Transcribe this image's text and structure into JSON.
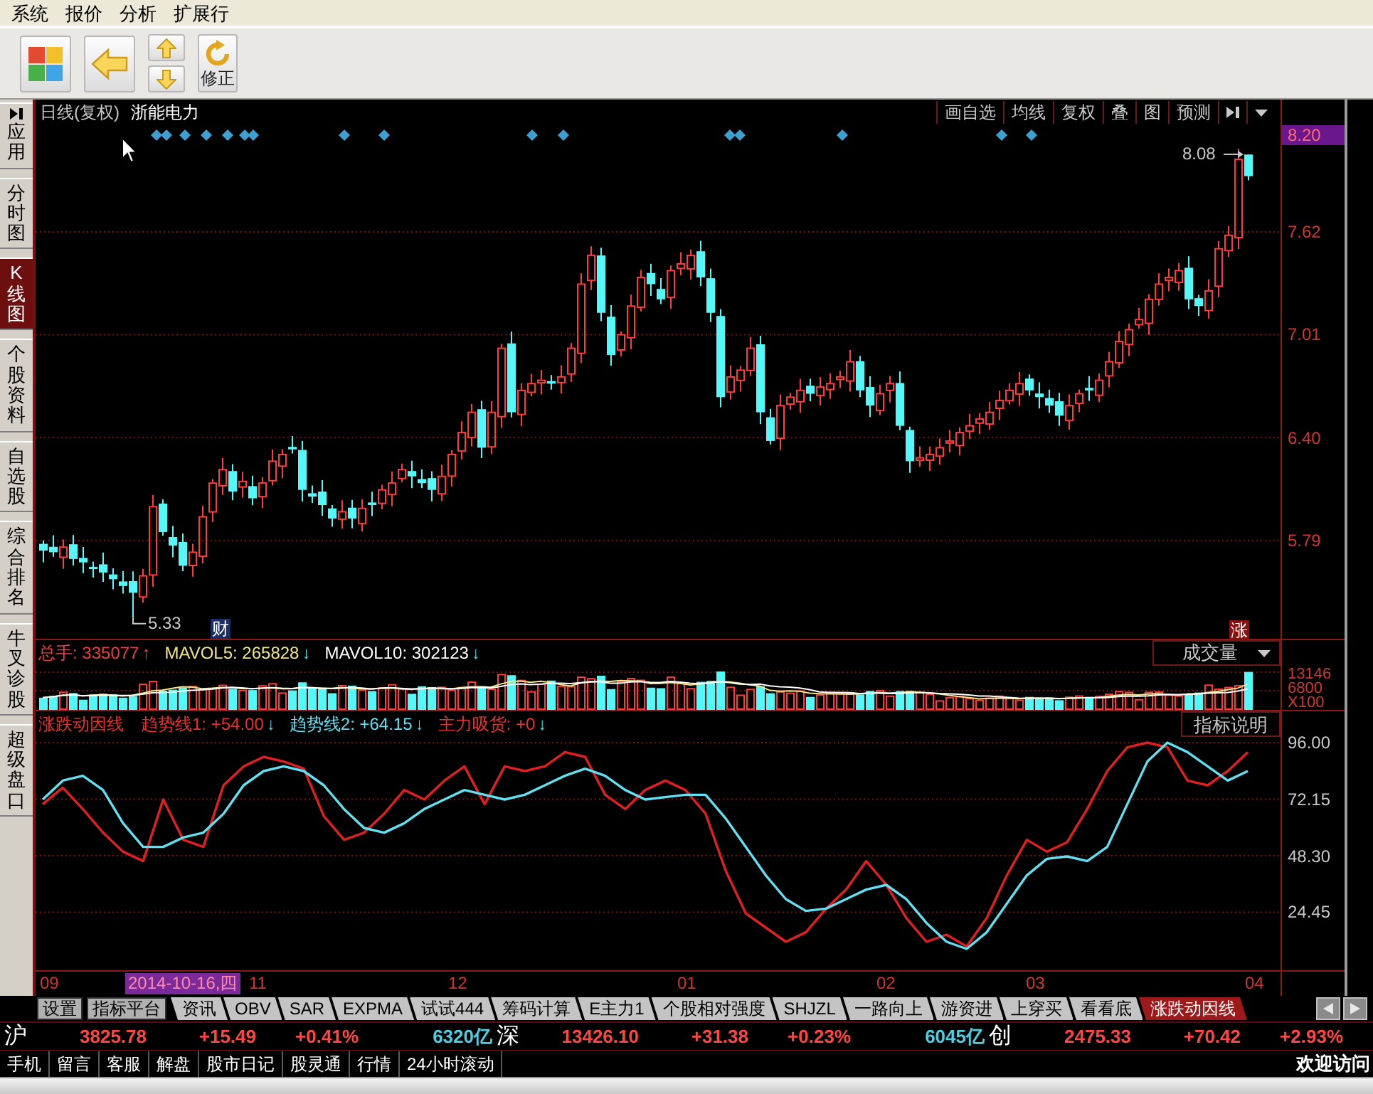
{
  "menu": [
    "系统",
    "报价",
    "分析",
    "扩展行"
  ],
  "toolbar": {
    "buttons": [
      {
        "kind": "home"
      },
      {
        "kind": "back"
      },
      {
        "kind": "up"
      },
      {
        "kind": "down"
      },
      {
        "kind": "refresh",
        "label": "修正"
      }
    ]
  },
  "sidebar": {
    "items": [
      {
        "label": "应用",
        "kind": "panel",
        "selected": false
      },
      {
        "label": "分时图",
        "kind": "tab",
        "selected": false
      },
      {
        "label": "K线图",
        "kind": "tab",
        "selected": true
      },
      {
        "label": "个股资料",
        "kind": "tab",
        "selected": false
      },
      {
        "label": "自选股",
        "kind": "tab",
        "selected": false
      },
      {
        "label": "综合排名",
        "kind": "tab",
        "selected": false
      },
      {
        "label": "牛叉诊股",
        "kind": "tab",
        "selected": false
      },
      {
        "label": "超级盘口",
        "kind": "tab",
        "selected": false
      }
    ]
  },
  "chart_header": {
    "period": "日线(复权)",
    "stock": "浙能电力",
    "buttons": [
      "画自选",
      "均线",
      "复权",
      "叠",
      "图",
      "预测"
    ]
  },
  "price_panel": {
    "current_price": "8.20",
    "axis_labels": [
      "7.62",
      "7.01",
      "6.40",
      "5.79"
    ],
    "high_label": "8.08",
    "low_label": "5.33",
    "markers": [
      {
        "text": "财",
        "kind": "finance"
      },
      {
        "text": "涨",
        "kind": "rise"
      }
    ]
  },
  "volume_panel": {
    "legend": [
      {
        "text": "总手: 335077",
        "arrow": "↑",
        "rising": true,
        "color": "#e84040"
      },
      {
        "text": "MAVOL5: 265828",
        "arrow": "↓",
        "rising": false,
        "color": "#f0e68c"
      },
      {
        "text": "MAVOL10: 302123",
        "arrow": "↓",
        "rising": false,
        "color": "#ffffff"
      }
    ],
    "selector": "成交量",
    "axis_labels": [
      "13146",
      "6800",
      "X100"
    ]
  },
  "indicator_panel": {
    "title": "涨跌动因线",
    "legend": [
      {
        "text": "趋势线1: +54.00",
        "arrow": "↓",
        "rising": false,
        "color": "#e83030"
      },
      {
        "text": "趋势线2: +64.15",
        "arrow": "↓",
        "rising": false,
        "color": "#60e0f0"
      },
      {
        "text": "主力吸货: +0",
        "arrow": "↓",
        "rising": false,
        "color": "#e83030"
      }
    ],
    "help_button": "指标说明",
    "chart_data": {
      "type": "line",
      "grid": true,
      "ylim": [
        0,
        98.4
      ],
      "yticks": [
        {
          "value": 96,
          "label": "96.00"
        },
        {
          "value": 72.15,
          "label": "72.15"
        },
        {
          "value": 48.3,
          "label": "48.30"
        },
        {
          "value": 24.45,
          "label": "24.45"
        }
      ],
      "series": [
        {
          "color": "#e02020",
          "values": [
            70,
            77,
            68,
            58,
            50,
            46,
            72,
            55,
            52,
            78,
            86,
            90,
            88,
            85,
            65,
            55,
            58,
            66,
            76,
            72,
            80,
            86,
            70,
            86,
            84,
            86,
            92,
            90,
            74,
            68,
            76,
            80,
            76,
            66,
            42,
            24,
            18,
            12,
            16,
            26,
            34,
            46,
            36,
            22,
            12,
            15,
            10,
            22,
            40,
            55,
            50,
            54,
            68,
            84,
            94,
            96,
            94,
            80,
            78,
            84,
            92
          ]
        },
        {
          "color": "#60e0f0",
          "values": [
            72,
            80,
            82,
            76,
            62,
            52,
            52,
            56,
            58,
            66,
            78,
            84,
            86,
            84,
            78,
            68,
            60,
            58,
            62,
            68,
            72,
            76,
            74,
            72,
            74,
            78,
            82,
            85,
            82,
            76,
            72,
            73,
            74,
            74,
            64,
            52,
            40,
            30,
            25,
            26,
            30,
            34,
            36,
            30,
            20,
            12,
            9,
            16,
            28,
            40,
            47,
            48,
            46,
            52,
            70,
            88,
            96,
            92,
            86,
            80,
            84
          ]
        }
      ]
    }
  },
  "time_axis": {
    "labels": [
      "09",
      "11",
      "12",
      "01",
      "02",
      "03",
      "04"
    ],
    "cursor_date": "2014-10-16,四"
  },
  "bottom_tabs": {
    "buttons": [
      "设置",
      "指标平台"
    ],
    "tabs": [
      {
        "label": "资讯",
        "selected": false
      },
      {
        "label": "OBV",
        "selected": false
      },
      {
        "label": "SAR",
        "selected": false
      },
      {
        "label": "EXPMA",
        "selected": false
      },
      {
        "label": "试试444",
        "selected": false
      },
      {
        "label": "筹码计算",
        "selected": false
      },
      {
        "label": "E主力1",
        "selected": false
      },
      {
        "label": "个股相对强度",
        "selected": false
      },
      {
        "label": "SHJZL",
        "selected": false
      },
      {
        "label": "一路向上",
        "selected": false
      },
      {
        "label": "游资进",
        "selected": false
      },
      {
        "label": "上穿买",
        "selected": false
      },
      {
        "label": "看看底",
        "selected": false
      },
      {
        "label": "涨跌动因线",
        "selected": true
      }
    ]
  },
  "index_bar": [
    {
      "market": "沪",
      "price": "3825.78",
      "change": "+15.49",
      "percent": "+0.41%",
      "turnover": "6320亿"
    },
    {
      "market": "深",
      "price": "13426.10",
      "change": "+31.38",
      "percent": "+0.23%",
      "turnover": "6045亿"
    },
    {
      "market": "创",
      "price": "2475.33",
      "change": "+70.42",
      "percent": "+2.93%"
    }
  ],
  "status_bar": {
    "links": [
      "手机",
      "留言",
      "客服",
      "解盘",
      "股市日记",
      "股灵通",
      "行情",
      "24小时滚动"
    ],
    "welcome": "欢迎访问"
  }
}
